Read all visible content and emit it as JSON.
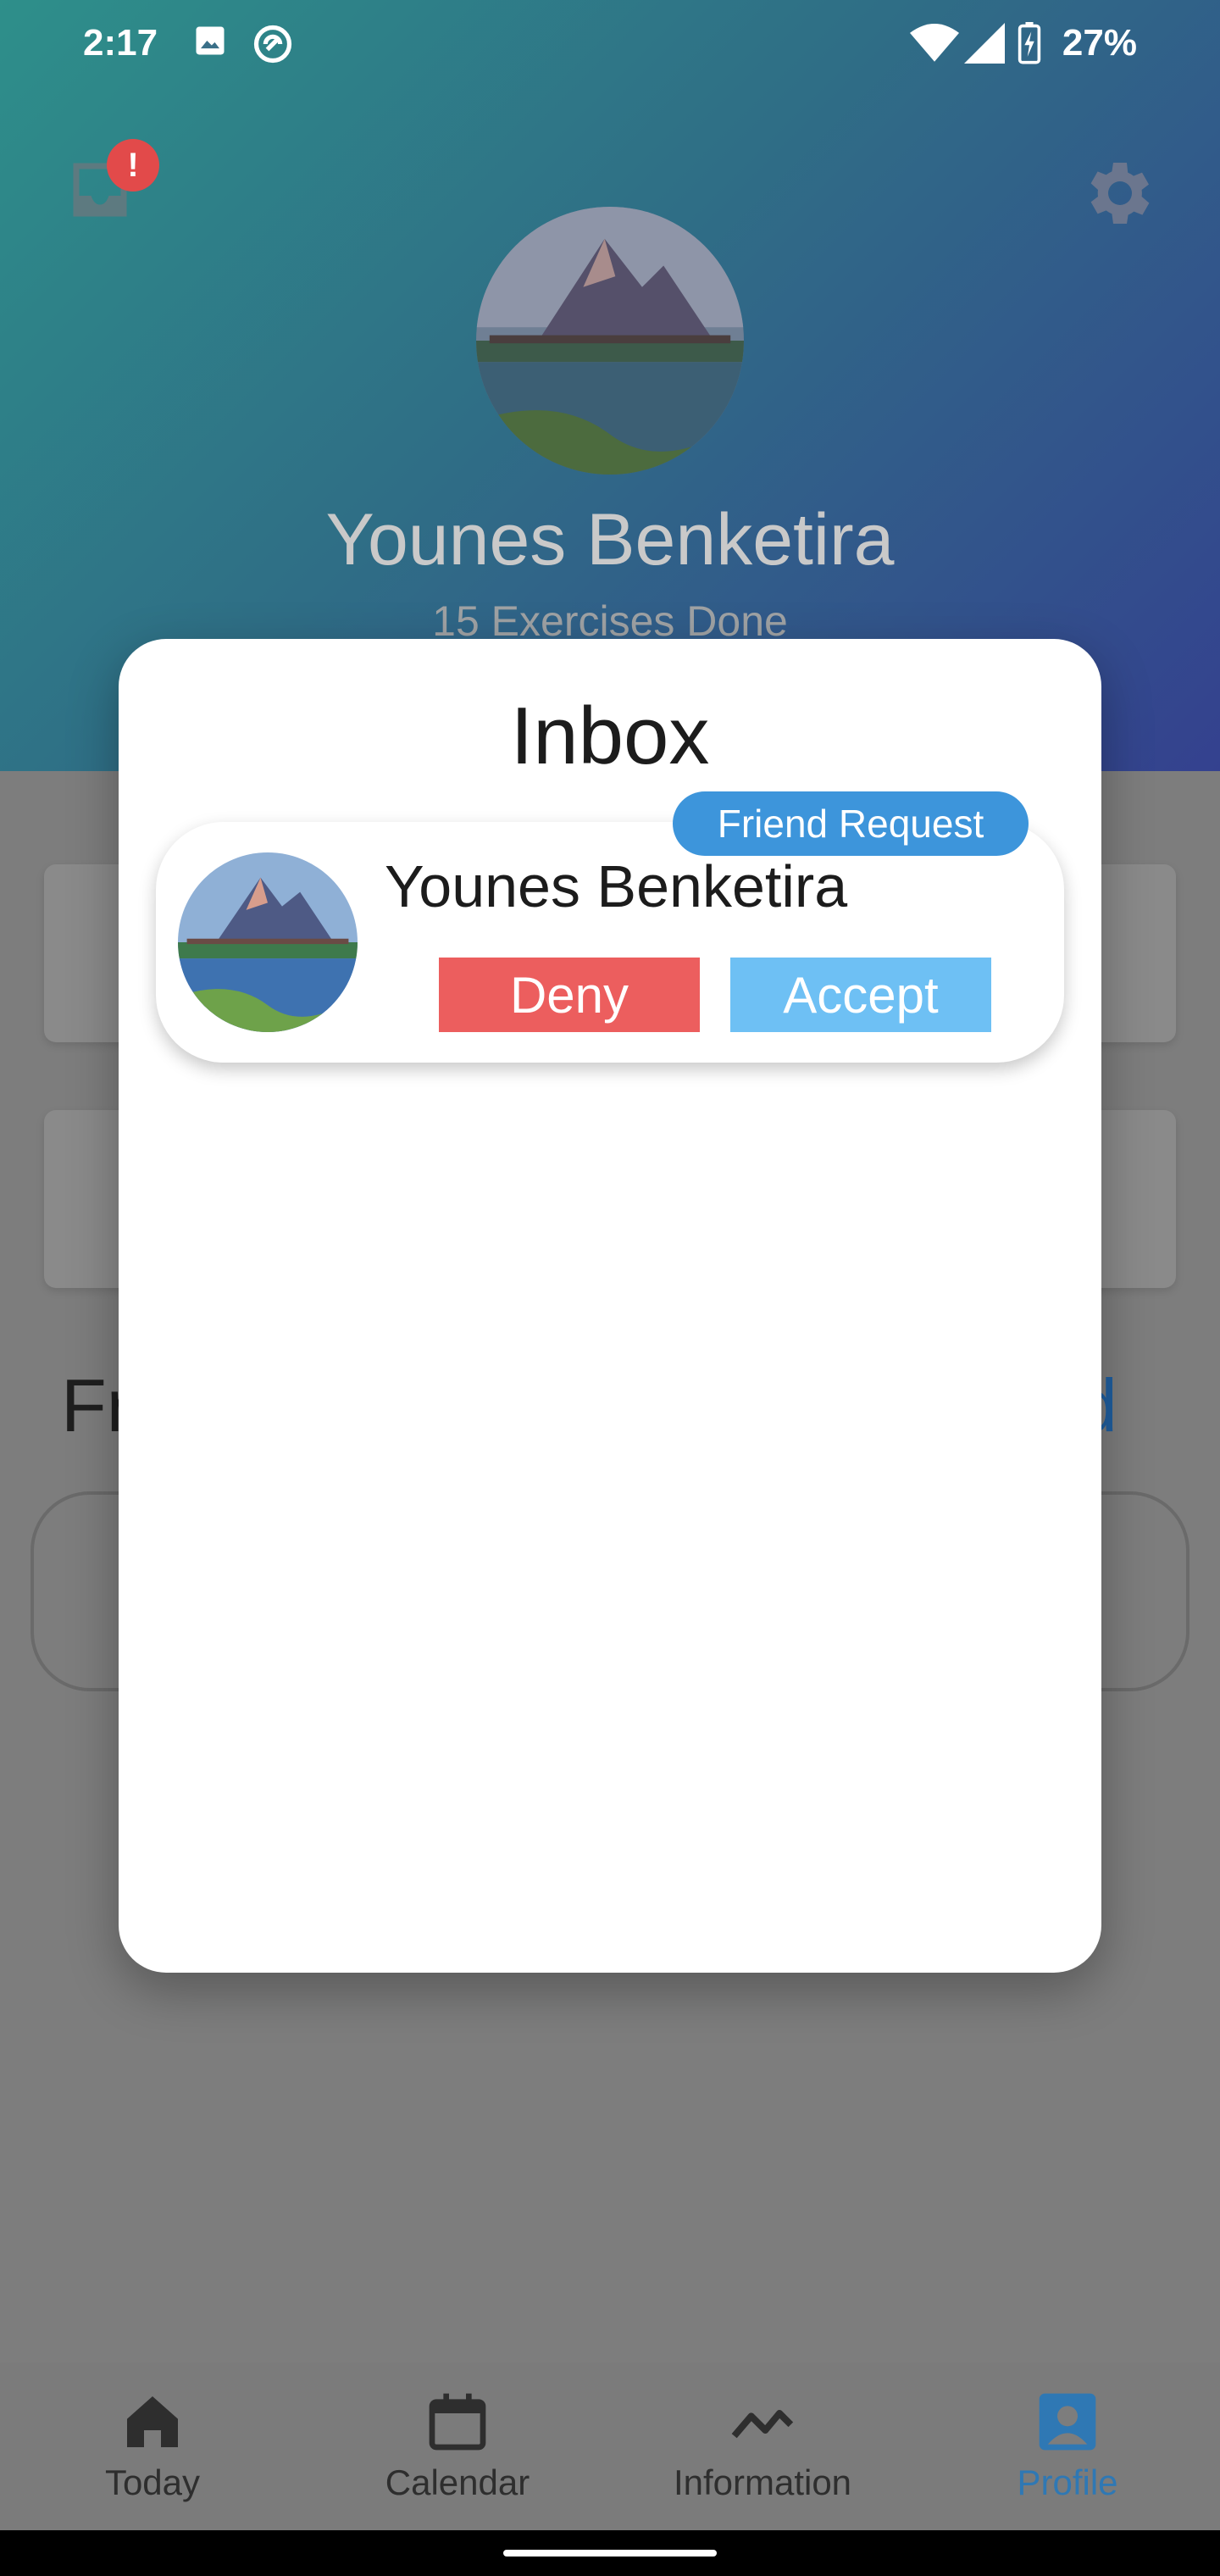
{
  "status_bar": {
    "time": "2:17",
    "battery": "27%",
    "icons": [
      "image-icon",
      "sync-icon",
      "wifi-icon",
      "signal-icon",
      "battery-charging-icon"
    ]
  },
  "header": {
    "inbox_badge": "!",
    "profile_name": "Younes Benketira",
    "profile_subtitle": "15 Exercises Done",
    "colors": {
      "gradient_start": "#2e8f8a",
      "gradient_end": "#34418f"
    }
  },
  "background": {
    "friends_heading": "Fr",
    "add_link": "d"
  },
  "modal": {
    "title": "Inbox",
    "requests": [
      {
        "name": "Younes Benketira",
        "type_badge": "Friend Request",
        "deny_label": "Deny",
        "accept_label": "Accept"
      }
    ],
    "colors": {
      "deny": "#ec5e5e",
      "accept": "#6ec0f4",
      "badge": "#3d95db"
    }
  },
  "bottom_nav": {
    "items": [
      {
        "label": "Today",
        "icon": "home-icon",
        "active": false
      },
      {
        "label": "Calendar",
        "icon": "calendar-icon",
        "active": false
      },
      {
        "label": "Information",
        "icon": "trend-icon",
        "active": false
      },
      {
        "label": "Profile",
        "icon": "profile-icon",
        "active": true
      }
    ],
    "active_color": "#2f78b4"
  }
}
